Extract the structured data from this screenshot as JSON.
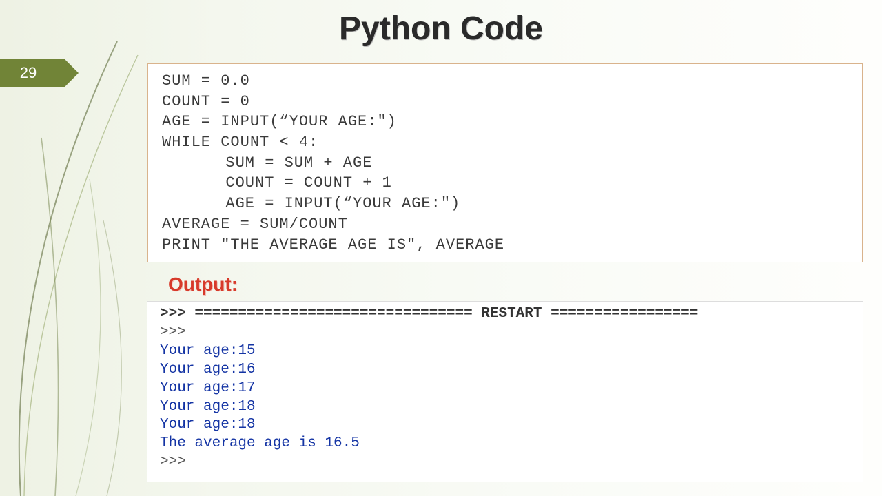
{
  "page_number": "29",
  "title": "Python Code",
  "code": {
    "l0": "SUM = 0.0",
    "l1": "COUNT = 0",
    "l2": "AGE = INPUT(“YOUR AGE:\")",
    "l3": "WHILE COUNT < 4:",
    "l4": "SUM = SUM + AGE",
    "l5": "COUNT = COUNT + 1",
    "l6": "AGE = INPUT(“YOUR AGE:\")",
    "l7": "AVERAGE = SUM/COUNT",
    "l8": "PRINT \"THE AVERAGE AGE IS\", AVERAGE"
  },
  "output_label": "Output:",
  "console": {
    "restart_line": ">>> ================================ RESTART =================",
    "prompt1": ">>> ",
    "line1": "Your age:15",
    "line2": "Your age:16",
    "line3": "Your age:17",
    "line4": "Your age:18",
    "line5": "Your age:18",
    "result": "The average age is 16.5",
    "prompt2": ">>> "
  }
}
